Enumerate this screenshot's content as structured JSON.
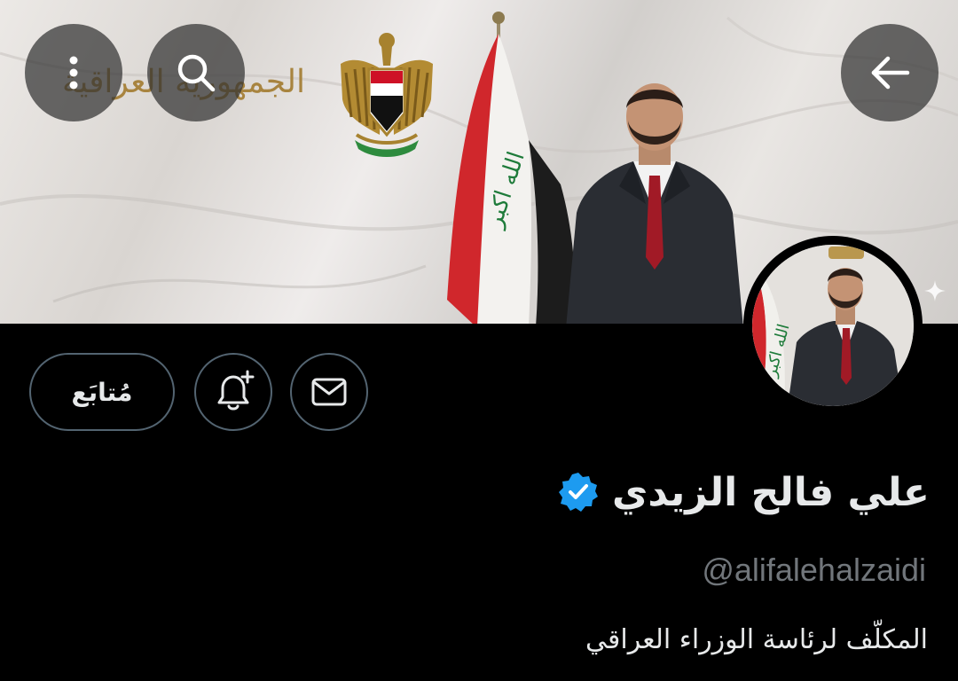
{
  "header": {
    "banner_text": "الجمهورية العراقية",
    "more_icon": "more-vertical-icon",
    "search_icon": "search-icon",
    "back_icon": "arrow-left-icon"
  },
  "actions": {
    "follow_label": "مُتابَع",
    "notify_icon": "bell-plus-icon",
    "message_icon": "envelope-icon"
  },
  "profile": {
    "display_name": "علي فالح الزيدي",
    "verified_icon": "verified-badge-icon",
    "handle": "@alifalehalzaidi",
    "bio": "المكلّف لرئاسة الوزراء العراقي"
  },
  "colors": {
    "background": "#000000",
    "text_primary": "#e7e9ea",
    "text_secondary": "#71767b",
    "button_border": "#536471",
    "verified_blue": "#1d9bf0"
  }
}
